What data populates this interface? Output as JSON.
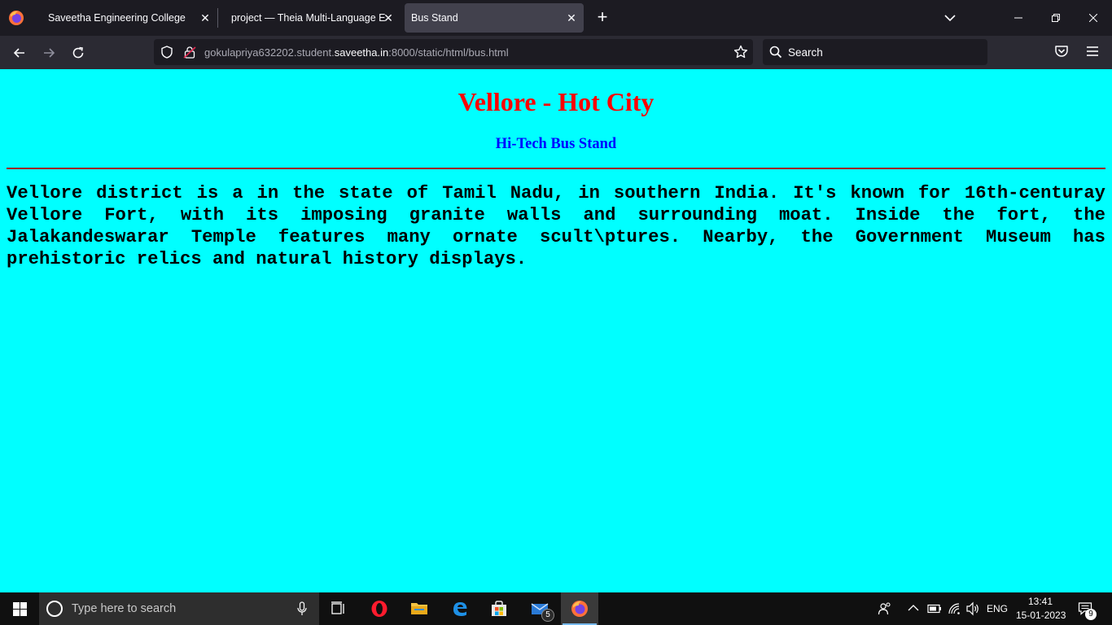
{
  "browser": {
    "tabs": [
      {
        "title": "Saveetha Engineering College"
      },
      {
        "title": "project — Theia Multi-Language Ex"
      },
      {
        "title": "Bus Stand"
      }
    ],
    "url": {
      "prefix": "gokulapriya632202.student.",
      "host": "saveetha.in",
      "suffix": ":8000/static/html/bus.html"
    },
    "search_placeholder": "Search"
  },
  "page": {
    "heading": "Vellore - Hot City",
    "subheading": "Hi-Tech Bus Stand",
    "paragraph": "Vellore district is a in the state of Tamil Nadu, in southern India. It's known for 16th-centuray Vellore Fort, with its imposing granite walls and surrounding moat. Inside the fort, the Jalakandeswarar Temple features many ornate scult\\ptures. Nearby, the Government Museum has prehistoric relics and natural history displays.",
    "background_color": "#00ffff",
    "heading_color": "#ff0000",
    "subheading_color": "#0000ff"
  },
  "taskbar": {
    "search_placeholder": "Type here to search",
    "mail_badge": "5",
    "language": "ENG",
    "time": "13:41",
    "date": "15-01-2023",
    "notification_count": "9"
  }
}
